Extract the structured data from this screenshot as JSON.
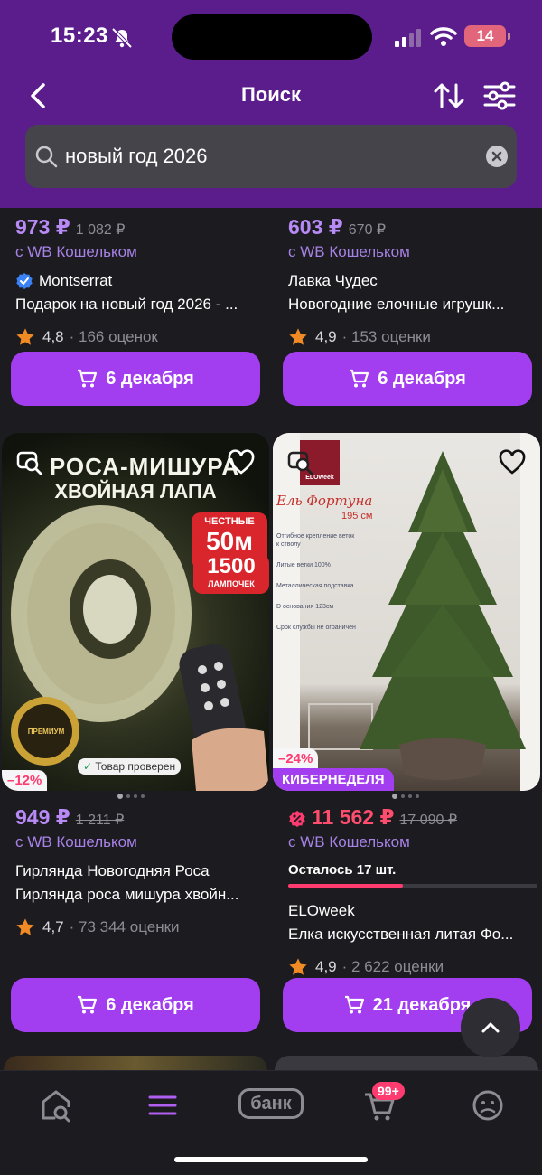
{
  "status": {
    "time": "15:23",
    "battery": "14"
  },
  "header": {
    "title": "Поиск"
  },
  "search": {
    "query": "новый год 2026"
  },
  "cards": [
    {
      "price": "973 ₽",
      "old_price": "1 082 ₽",
      "wallet": "с WB Кошельком",
      "brand": "Montserrat",
      "name": "Подарок на новый год 2026 - ...",
      "rating": "4,8",
      "reviews": "· 166 оценок",
      "delivery": "6 декабря"
    },
    {
      "price": "603 ₽",
      "old_price": "670 ₽",
      "wallet": "с WB Кошельком",
      "brand": "Лавка Чудес",
      "name": "Новогодние елочные игрушк...",
      "rating": "4,9",
      "reviews": "· 153 оценки",
      "delivery": "6 декабря"
    },
    {
      "image_alt": "Роса-мишура хвойная лапа",
      "discount": "–12%",
      "price": "949 ₽",
      "old_price": "1 211 ₽",
      "wallet": "с WB Кошельком",
      "brand": "Гирлянда Новогодняя Роса",
      "name": "Гирлянда роса мишура хвойн...",
      "rating": "4,7",
      "reviews": "· 73 344 оценки",
      "delivery": "6 декабря"
    },
    {
      "image_alt": "Ель Фортуна 195 см",
      "discount": "–24%",
      "promo": "КИБЕРНЕДЕЛЯ",
      "price": "11 562 ₽",
      "old_price": "17 090 ₽",
      "wallet": "с WB Кошельком",
      "stock": "Осталось 17 шт.",
      "stock_fraction": 0.46,
      "brand": "ELOweek",
      "name": "Елка искусственная литая Фо...",
      "rating": "4,9",
      "reviews": "· 2 622 оценки",
      "delivery": "21 декабря"
    }
  ],
  "product1_overlay": {
    "headline1": "РОСА-МИШУРА",
    "headline2": "ХВОЙНАЯ ЛАПА",
    "badge1_top": "ЧЕСТНЫЕ",
    "badge1_main": "50м",
    "badge2_main": "1500",
    "badge2_sub": "ЛАМПОЧЕК",
    "seal": "ПРЕМИУМ",
    "verified": "Товар проверен"
  },
  "product2_overlay": {
    "brand_logo": "ELOweek",
    "title": "Ель Фортуна",
    "size": "195 см",
    "features": [
      "Отгибное крепление веток к стволу",
      "Литые ветки 100%",
      "Металлическая подставка",
      "D основания 123см",
      "Срок службы не ограничен"
    ]
  },
  "tabbar": {
    "bank": "банк",
    "cart_badge": "99+"
  },
  "colors": {
    "header": "#5b1d8c",
    "accent": "#a33df0",
    "price": "#b88af5",
    "sale": "#ff3b6f",
    "rating_star": "#f08a24"
  }
}
